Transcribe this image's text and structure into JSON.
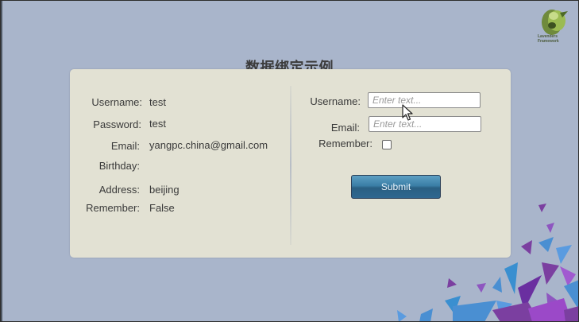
{
  "title": "数据绑定示例",
  "logo": {
    "icon": "green-bird-logo-icon",
    "text": "Lavenders Framework"
  },
  "display": {
    "username": {
      "label": "Username:",
      "value": "test"
    },
    "password": {
      "label": "Password:",
      "value": "test"
    },
    "email": {
      "label": "Email:",
      "value": "yangpc.china@gmail.com"
    },
    "birthday": {
      "label": "Birthday:",
      "value": ""
    },
    "address": {
      "label": "Address:",
      "value": "beijing"
    },
    "remember": {
      "label": "Remember:",
      "value": "False"
    }
  },
  "form": {
    "username": {
      "label": "Username:",
      "placeholder": "Enter text..."
    },
    "email": {
      "label": "Email:",
      "placeholder": "Enter text..."
    },
    "remember": {
      "label": "Remember:",
      "checked": false
    },
    "submit_label": "Submit"
  },
  "colors": {
    "background": "#a9b5cb",
    "panel": "#e2e1d3",
    "button": "#3a7ea6",
    "decor_purple": "#7b3fa0",
    "decor_blue": "#3a8fd0"
  }
}
